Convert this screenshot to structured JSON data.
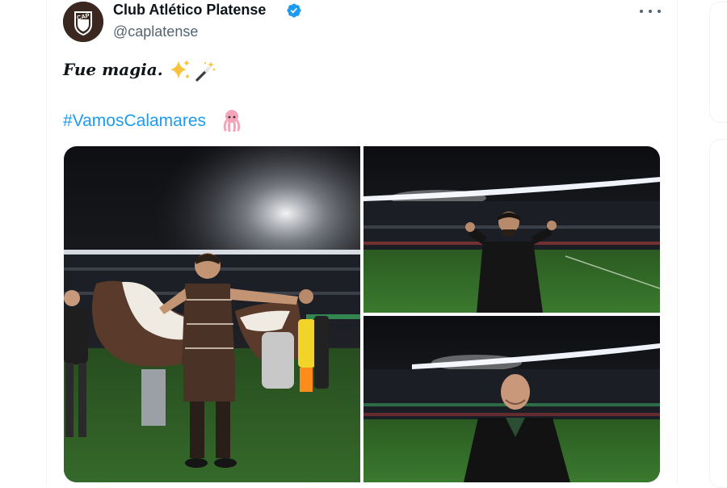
{
  "author": {
    "display_name": "Club Atlético Platense",
    "handle": "@caplatense",
    "avatar_text": "CAP",
    "verified": true
  },
  "tweet": {
    "text": "Fue magia.",
    "hashtag": "#VamosCalamares"
  },
  "icons": {
    "verified": "verified-badge-icon",
    "more": "more-options-icon",
    "sparkles": "sparkles-emoji",
    "wand": "magic-wand-emoji",
    "squid": "squid-emoji"
  },
  "colors": {
    "link": "#1d9bf0",
    "secondary_text": "#536471",
    "verified": "#1d9bf0",
    "primary_text": "#0f1419",
    "pitch": "#2d5c23",
    "night_sky": "#14161a",
    "club_brown": "#5a3a2a"
  },
  "media": [
    {
      "name": "players-celebrating-with-flag"
    },
    {
      "name": "coach-thumbs-up-on-pitch"
    },
    {
      "name": "man-smiling-in-stadium"
    }
  ]
}
